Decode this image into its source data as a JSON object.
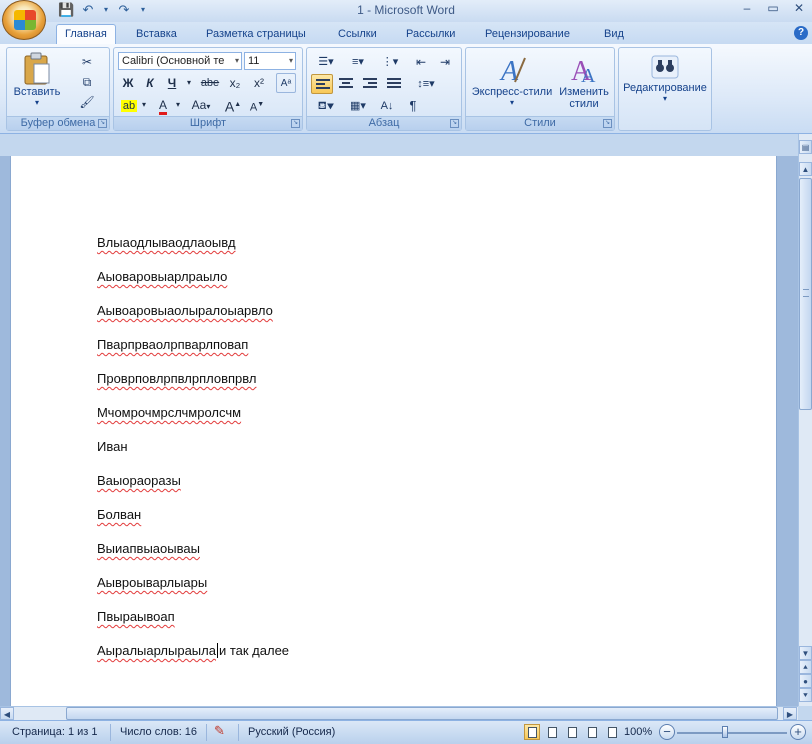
{
  "window": {
    "title": "1 - Microsoft Word",
    "controls": [
      "–",
      "▭",
      "✕"
    ]
  },
  "quick_access": {
    "save_icon": "save-icon",
    "undo_icon": "undo-icon",
    "redo_icon": "redo-icon",
    "customize_icon": "chevron-down-icon"
  },
  "tabs": [
    {
      "label": "Главная",
      "active": true
    },
    {
      "label": "Вставка"
    },
    {
      "label": "Разметка страницы"
    },
    {
      "label": "Ссылки"
    },
    {
      "label": "Рассылки"
    },
    {
      "label": "Рецензирование"
    },
    {
      "label": "Вид"
    }
  ],
  "ribbon": {
    "clipboard": {
      "label": "Буфер обмена",
      "paste_label": "Вставить"
    },
    "font": {
      "label": "Шрифт",
      "font_name": "Calibri (Основной те",
      "font_size": "11",
      "bold": "Ж",
      "italic": "К",
      "underline": "Ч",
      "strike": "abe",
      "subscript": "x₂",
      "superscript": "x²",
      "change_case": "Aa",
      "grow": "A",
      "shrink": "A"
    },
    "paragraph": {
      "label": "Абзац",
      "pilcrow": "¶"
    },
    "styles": {
      "label": "Стили",
      "express": "Экспресс-стили",
      "change_line1": "Изменить",
      "change_line2": "стили"
    },
    "editing": {
      "label": "Редактирование"
    }
  },
  "document": {
    "lines": [
      "Влыаодлываодлаоывд",
      "Аыоваровыарлраыло",
      "Аывоаровыаолыралоыарвло",
      "Пварпрваолрпварлповап",
      "Проврповлрпвлрпловпрвл",
      "Мчомрочмрслчмролсчм",
      "Иван",
      "Ваыораоразы",
      "Болван",
      "Выиапвыаоываы",
      "Аывроыварлыары",
      "Пвыраывоап"
    ],
    "last_line_misspelled": "Аыралыарлыраыла",
    "last_line_rest": "и так далее"
  },
  "statusbar": {
    "page": "Страница: 1 из 1",
    "words": "Число слов: 16",
    "language": "Русский (Россия)",
    "zoom": "100%"
  }
}
